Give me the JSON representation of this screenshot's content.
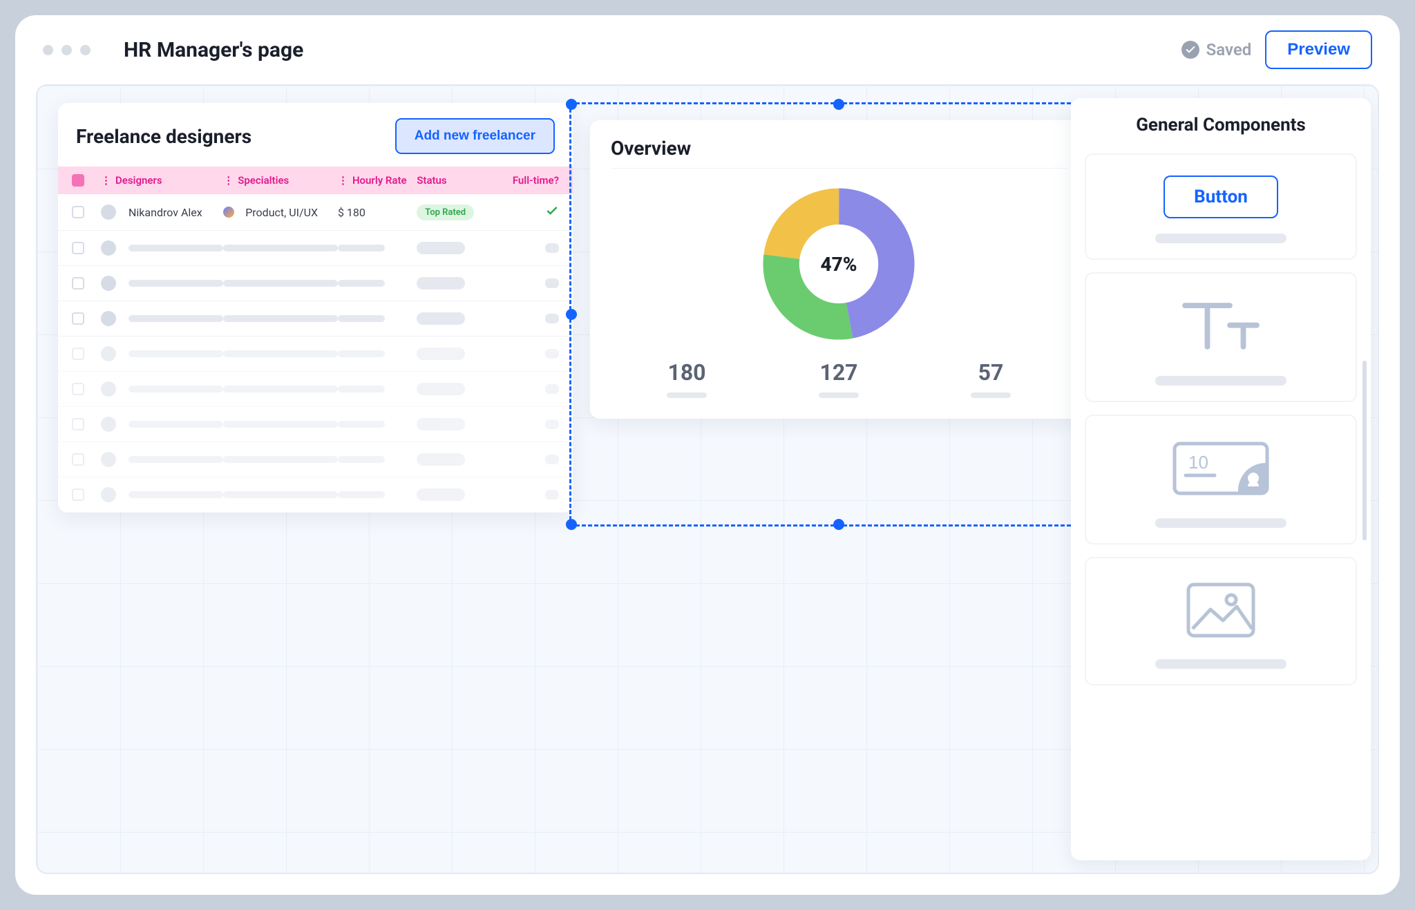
{
  "page_title": "HR Manager's page",
  "header": {
    "saved_label": "Saved",
    "preview_label": "Preview"
  },
  "freelancers": {
    "title": "Freelance designers",
    "add_button_label": "Add new freelancer",
    "columns": {
      "designers": "Designers",
      "specialties": "Specialties",
      "hourly_rate": "Hourly Rate",
      "status": "Status",
      "fulltime": "Full-time?"
    },
    "rows": [
      {
        "name": "Nikandrov Alex",
        "specialties": "Product, UI/UX",
        "rate": "$ 180",
        "status": "Top Rated",
        "fulltime": true
      }
    ]
  },
  "overview": {
    "title": "Overview",
    "center_label": "47%",
    "stats": [
      {
        "value": "180"
      },
      {
        "value": "127"
      },
      {
        "value": "57"
      }
    ]
  },
  "components_panel": {
    "title": "General Components",
    "button_label": "Button",
    "card_number": "10"
  },
  "chart_data": {
    "type": "pie",
    "title": "Overview",
    "center_value": 47,
    "center_label": "47%",
    "slices": [
      {
        "name": "purple",
        "value": 47,
        "color": "#8B8AE6"
      },
      {
        "name": "green",
        "value": 30,
        "color": "#6BCB6F"
      },
      {
        "name": "yellow",
        "value": 23,
        "color": "#F2C148"
      }
    ],
    "summary_values": [
      180,
      127,
      57
    ]
  },
  "colors": {
    "primary": "#1463FF",
    "pink_header": "#FFD8EB",
    "pink_text": "#E21A8F",
    "badge_green_bg": "#DDF5E1",
    "badge_green_fg": "#2EA84A"
  }
}
